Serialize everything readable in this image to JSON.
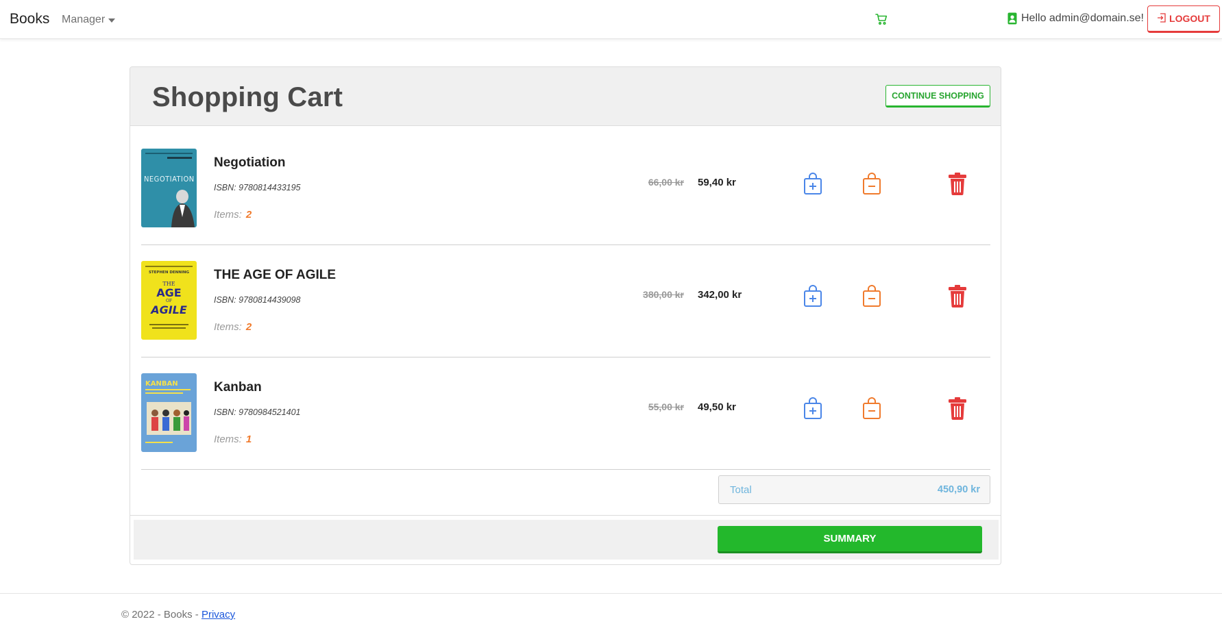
{
  "navbar": {
    "brand": "Books",
    "manager_label": "Manager",
    "greeting": "Hello admin@domain.se!",
    "logout_label": "LOGOUT"
  },
  "cart": {
    "title": "Shopping Cart",
    "continue_label": "CONTINUE SHOPPING",
    "items_label": "Items:",
    "items": [
      {
        "title": "Negotiation",
        "isbn": "ISBN: 9780814433195",
        "count": "2",
        "old_price": "66,00 kr",
        "new_price": "59,40 kr",
        "cover_color": "#2f8fa8"
      },
      {
        "title": "THE AGE OF AGILE",
        "isbn": "ISBN: 9780814439098",
        "count": "2",
        "old_price": "380,00 kr",
        "new_price": "342,00 kr",
        "cover_color": "#f0e21c"
      },
      {
        "title": "Kanban",
        "isbn": "ISBN: 9780984521401",
        "count": "1",
        "old_price": "55,00 kr",
        "new_price": "49,50 kr",
        "cover_color": "#6aa3d8"
      }
    ],
    "total_label": "Total",
    "total_value": "450,90 kr",
    "summary_label": "SUMMARY"
  },
  "footer": {
    "copyright": "© 2022 - Books - ",
    "privacy_label": "Privacy"
  },
  "colors": {
    "accent_green": "#23b82c",
    "danger_red": "#e53b3b",
    "plus_blue": "#4a86e8",
    "minus_orange": "#f07a2c",
    "total_blue": "#6fb5dd"
  }
}
